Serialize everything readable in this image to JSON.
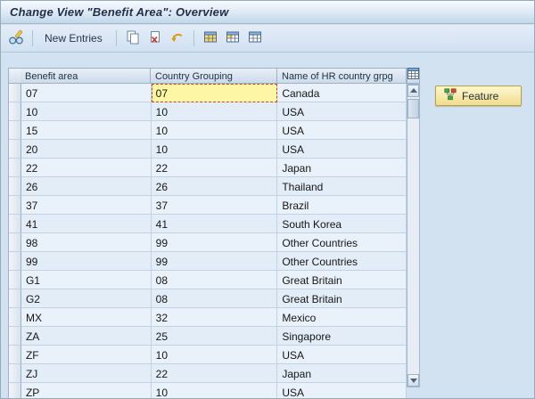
{
  "window": {
    "title": "Change View \"Benefit Area\": Overview"
  },
  "toolbar": {
    "new_entries_label": "New Entries",
    "icons": [
      "display-change-icon",
      "copy-as-icon",
      "delete-icon",
      "undo-change-icon",
      "select-all-icon",
      "select-block-icon",
      "deselect-all-icon"
    ]
  },
  "table": {
    "columns": [
      "Benefit area",
      "Country Grouping",
      "Name of HR country grpg"
    ],
    "rows": [
      [
        "07",
        "07",
        "Canada"
      ],
      [
        "10",
        "10",
        "USA"
      ],
      [
        "15",
        "10",
        "USA"
      ],
      [
        "20",
        "10",
        "USA"
      ],
      [
        "22",
        "22",
        "Japan"
      ],
      [
        "26",
        "26",
        "Thailand"
      ],
      [
        "37",
        "37",
        "Brazil"
      ],
      [
        "41",
        "41",
        "South Korea"
      ],
      [
        "98",
        "99",
        "Other Countries"
      ],
      [
        "99",
        "99",
        "Other Countries"
      ],
      [
        "G1",
        "08",
        "Great Britain"
      ],
      [
        "G2",
        "08",
        "Great Britain"
      ],
      [
        "MX",
        "32",
        "Mexico"
      ],
      [
        "ZA",
        "25",
        "Singapore"
      ],
      [
        "ZF",
        "10",
        "USA"
      ],
      [
        "ZJ",
        "22",
        "Japan"
      ],
      [
        "ZP",
        "10",
        "USA"
      ]
    ],
    "active_cell": {
      "row": 0,
      "col": 1
    },
    "config_icon": "table-settings-icon"
  },
  "scrollbar": {
    "up_icon": "scroll-up-icon",
    "down_icon": "scroll-down-icon",
    "thumb_position": "top"
  },
  "side_panel": {
    "feature_button_label": "Feature",
    "feature_icon": "feature-hierarchy-icon"
  },
  "colors": {
    "active_cell_bg": "#fdf6a4",
    "active_cell_border": "#c7452e",
    "feature_button_bg": "#f1dd8e",
    "titlebar_text": "#20304a",
    "content_bg": "#d3e2f1"
  }
}
